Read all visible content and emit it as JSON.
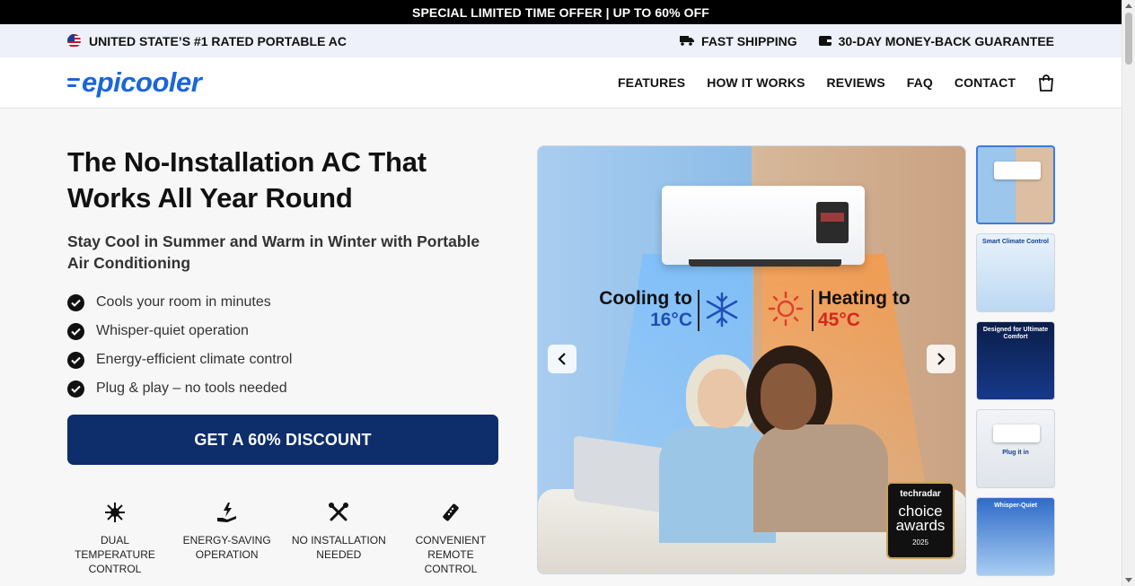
{
  "offer_bar": {
    "text": "SPECIAL LIMITED TIME OFFER | UP TO 60% OFF"
  },
  "trust_bar": {
    "left": "UNITED STATE’S #1 RATED PORTABLE AC",
    "shipping": "FAST SHIPPING",
    "guarantee": "30-DAY MONEY-BACK GUARANTEE"
  },
  "nav": {
    "logo": "epicooler",
    "items": [
      "FEATURES",
      "HOW IT WORKS",
      "REVIEWS",
      "FAQ",
      "CONTACT"
    ],
    "cart_icon": "shopping-bag-icon"
  },
  "hero": {
    "title": "The No-Installation AC That Works All Year Round",
    "subtitle": "Stay Cool in Summer and Warm in Winter with Portable Air Conditioning",
    "bullets": [
      "Cools your room in minutes",
      "Whisper-quiet operation",
      "Energy-efficient climate control",
      "Plug & play – no tools needed"
    ],
    "cta": "GET A 60% DISCOUNT"
  },
  "features": [
    {
      "icon": "snowflake-sun-icon",
      "label": "DUAL TEMPERATURE CONTROL"
    },
    {
      "icon": "energy-hand-icon",
      "label": "ENERGY-SAVING OPERATION"
    },
    {
      "icon": "tools-icon",
      "label": "NO INSTALLATION NEEDED"
    },
    {
      "icon": "remote-icon",
      "label": "CONVENIENT REMOTE CONTROL"
    }
  ],
  "carousel": {
    "cool_label": "Cooling to",
    "cool_temp": "16°C",
    "heat_label": "Heating to",
    "heat_temp": "45°C",
    "badge_brand": "techradar",
    "badge_title": "choice awards",
    "badge_year": "2025"
  },
  "thumbnails": [
    {
      "label": ""
    },
    {
      "label": "Smart Climate Control"
    },
    {
      "label": "Designed for Ultimate Comfort"
    },
    {
      "label": "Plug it in"
    },
    {
      "label": "Whisper-Quiet"
    }
  ],
  "colors": {
    "cta_bg": "#0d2d6b",
    "logo": "#1a66d9",
    "cool": "#1f4fb5",
    "heat": "#d8261e"
  }
}
